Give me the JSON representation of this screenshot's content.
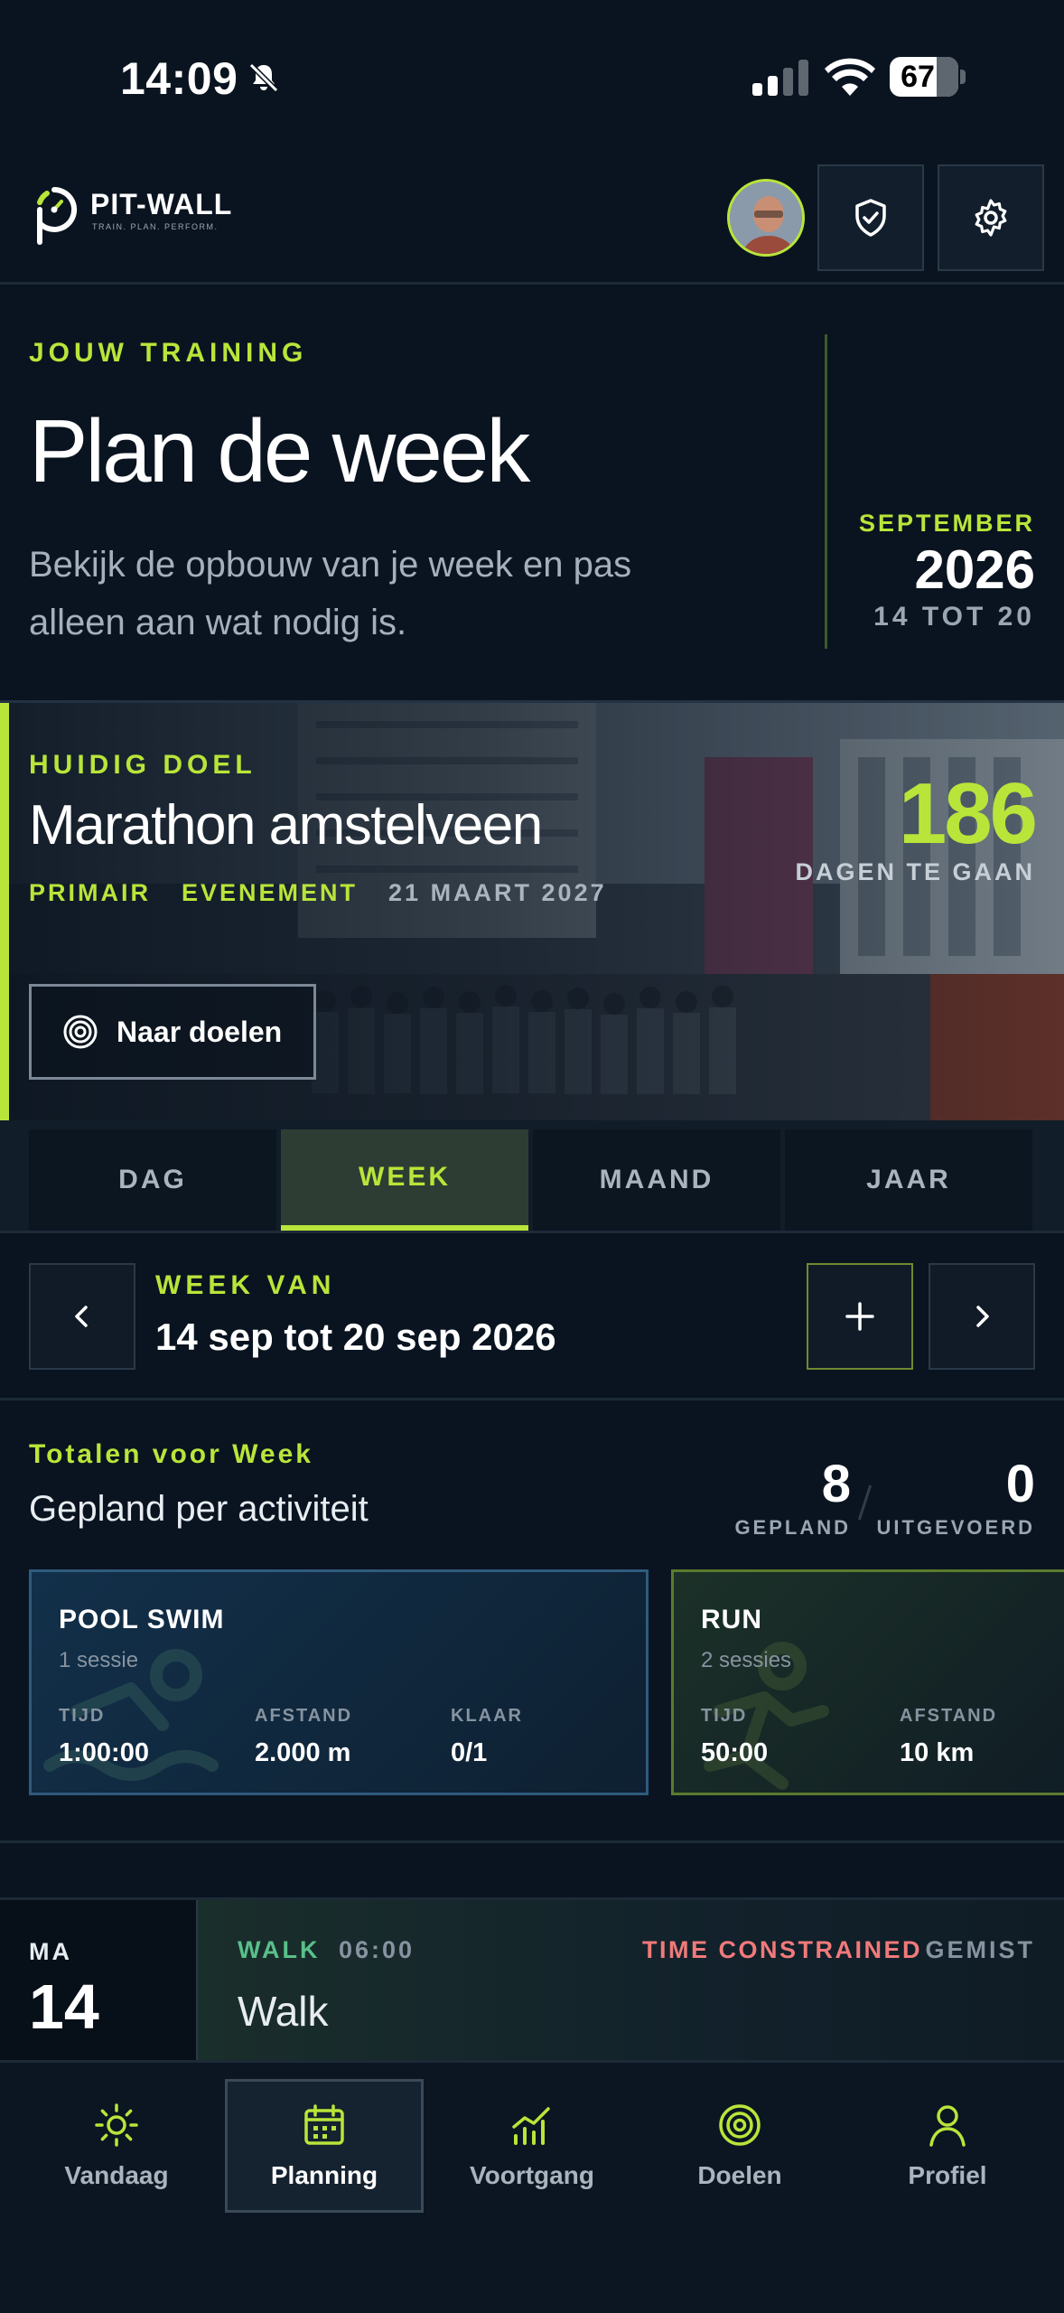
{
  "status_bar": {
    "time": "14:09",
    "battery": "67"
  },
  "header": {
    "logo_title": "PIT-WALL",
    "logo_tagline": "TRAIN. PLAN. PERFORM."
  },
  "hero": {
    "eyebrow": "JOUW TRAINING",
    "title": "Plan de week",
    "description": "Bekijk de opbouw van je week en pas alleen aan wat nodig is.",
    "month": "SEPTEMBER",
    "year": "2026",
    "range": "14 TOT 20"
  },
  "goal": {
    "eyebrow": "HUIDIG DOEL",
    "title": "Marathon amstelveen",
    "tags": [
      "PRIMAIR",
      "EVENEMENT"
    ],
    "date": "21 MAART 2027",
    "days_count": "186",
    "days_label": "DAGEN TE GAAN",
    "button_label": "Naar doelen"
  },
  "segments": [
    "DAG",
    "WEEK",
    "MAAND",
    "JAAR"
  ],
  "active_segment": "WEEK",
  "week_nav": {
    "eyebrow": "WEEK VAN",
    "range": "14 sep tot 20 sep 2026"
  },
  "totals": {
    "eyebrow": "Totalen voor Week",
    "subtitle": "Gepland per activiteit",
    "planned": "8",
    "planned_label": "GEPLAND",
    "done": "0",
    "done_label": "UITGEVOERD",
    "cards": [
      {
        "title": "POOL SWIM",
        "sessions": "1 sessie",
        "stats": [
          {
            "label": "TIJD",
            "value": "1:00:00"
          },
          {
            "label": "AFSTAND",
            "value": "2.000 m"
          },
          {
            "label": "KLAAR",
            "value": "0/1"
          }
        ]
      },
      {
        "title": "RUN",
        "sessions": "2 sessies",
        "stats": [
          {
            "label": "TIJD",
            "value": "50:00"
          },
          {
            "label": "AFSTAND",
            "value": "10 km"
          }
        ]
      }
    ]
  },
  "day": {
    "abbr": "MA",
    "number": "14",
    "activity_type": "WALK",
    "activity_time": "06:00",
    "flag": "TIME CONSTRAINED",
    "status": "GEMIST",
    "name": "Walk"
  },
  "tabs": [
    {
      "label": "Vandaag",
      "icon": "sun-icon"
    },
    {
      "label": "Planning",
      "icon": "calendar-icon"
    },
    {
      "label": "Voortgang",
      "icon": "chart-icon"
    },
    {
      "label": "Doelen",
      "icon": "target-icon"
    },
    {
      "label": "Profiel",
      "icon": "person-icon"
    }
  ],
  "colors": {
    "accent": "#b9e53a",
    "background": "#0a1420",
    "walk": "#59c08a",
    "warning": "#f07a7a"
  }
}
